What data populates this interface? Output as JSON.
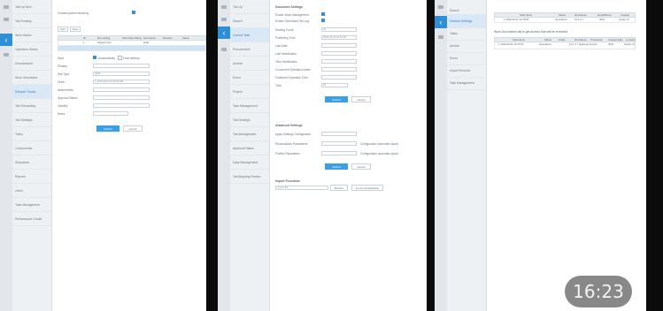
{
  "panel1": {
    "sidebar": [
      "Tab Up Next",
      "Tab Runway",
      "Work Status",
      "Operation Status",
      "Unscheduled",
      "Work Orientation",
      "Delayed Trucks",
      "Tab Scheduling",
      "Tab Strategic",
      "Tasks",
      "Components",
      "Shipments",
      "Reports",
      "Users",
      "Tabs Management",
      "Performance Center"
    ],
    "active_index": 6,
    "header_text": "Created parent hierarchy",
    "header_check": "",
    "tabs": [
      "Edit",
      "Move"
    ],
    "table_cols": [
      "ID",
      "Rev Adding",
      "Start Date Adding",
      "Description",
      "Revision",
      "Status"
    ],
    "table_row": [
      "1",
      "Staged rows",
      "",
      "",
      "",
      "Draft"
    ],
    "form_labels": [
      "Start",
      "Primary",
      "Site Type",
      "Order",
      "Attachments",
      "Approval Status",
      "Visibility",
      "Notes"
    ],
    "form_values": [
      "",
      "",
      "2020",
      "1 2023-2024 02:20:04 AM",
      "",
      "",
      "",
      ""
    ],
    "radio_a": "Automatically",
    "radio_b": "Final delivery",
    "submit": "Submit",
    "cancel": "Cancel"
  },
  "panel2": {
    "sidebar": [
      "Tab Up",
      "Search",
      "Current Task",
      "Procurement",
      "Archive",
      "Event",
      "Project",
      "Task Management",
      "Tab Strategic",
      "Tab Management",
      "Approval Status",
      "Daily Management",
      "Tab Mapping Review"
    ],
    "active_index": 2,
    "section1": "Document Settings",
    "form_labels": [
      "Enable Work Management",
      "Enable Scheduled Tab Log",
      "Starting Count",
      "Publishing Time",
      "Last Date",
      "Last Modification",
      "Time Modification",
      "Concurrent Operation Notes",
      "Published Expiration Time",
      "Total"
    ],
    "form_values": [
      "",
      "",
      "10",
      "2020-02-01 22:15:00",
      "",
      "",
      "",
      "",
      "",
      "10"
    ],
    "submit": "Submit",
    "cancel": "Cancel",
    "section2": "Advanced Settings",
    "adv_labels": [
      "Apply Settings Configuration",
      "Recalculation Parameters",
      "Publish Parameters"
    ],
    "adv_values": [
      "",
      "",
      ""
    ],
    "adv_hints": [
      "Configuration automatic layout",
      "Configuration automatic layout"
    ],
    "submit2": "Submit",
    "cancel2": "Cancel",
    "section3": "Import Functions",
    "import_field": "Import file",
    "browse": "Browse",
    "import_btn": "Import Spreadsheet"
  },
  "panel3": {
    "sidebar": [
      "Search",
      "General Settings",
      "Tasks",
      "Archive",
      "Event",
      "Import Records",
      "Task Management"
    ],
    "active_index": 1,
    "table1_cols": [
      "Task Name",
      "Status",
      "ID Address",
      "Email/Phone",
      "Created"
    ],
    "table1_row": [
      "1 2020-02-01 20:15:00",
      "Operations",
      "10.1.2.7",
      "4021",
      "Inquiry Ct"
    ],
    "section": "Work Documents list to get access that will be removed",
    "table2_cols": [
      "Task Name",
      "Status",
      "Fields",
      "ID Address",
      "Timestamp",
      "Created Date",
      "Location"
    ],
    "table2_row": [
      "1 2020-02-01 20:15:00",
      "Operations",
      "",
      "",
      "10.1.2.7 deployed service",
      "4021",
      "Inquiry Ct"
    ]
  },
  "timestamp": "16:23"
}
